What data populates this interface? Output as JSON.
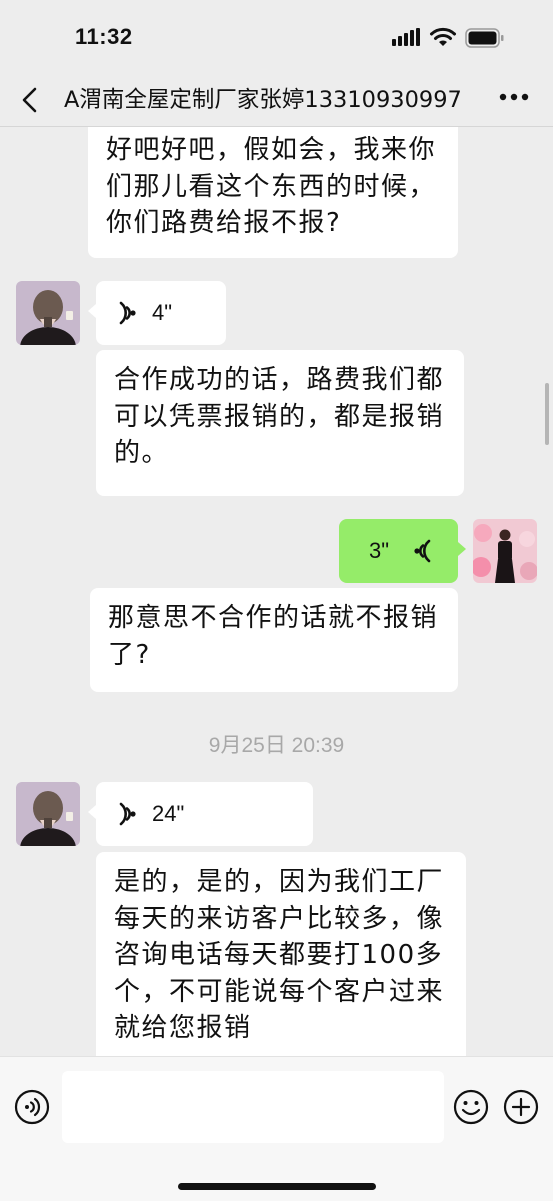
{
  "status_bar": {
    "time": "11:32"
  },
  "header": {
    "title": "A渭南全屋定制厂家张婷13310930997"
  },
  "messages": [
    {
      "from": "self",
      "type": "text",
      "text": "好吧好吧，假如会，我来你们那儿看这个东西的时候，你们路费给报不报?"
    },
    {
      "from": "other",
      "type": "voice",
      "duration": "4\""
    },
    {
      "from": "other",
      "type": "text",
      "text": "合作成功的话，路费我们都可以凭票报销的，都是报销的。"
    },
    {
      "from": "self",
      "type": "voice",
      "duration": "3\""
    },
    {
      "from": "self",
      "type": "text",
      "text": "那意思不合作的话就不报销了?"
    },
    {
      "type": "timestamp",
      "text": "9月25日 20:39"
    },
    {
      "from": "other",
      "type": "voice",
      "duration": "24\""
    },
    {
      "from": "other",
      "type": "text",
      "text": "是的，是的，因为我们工厂每天的来访客户比较多，像咨询电话每天都要打100多个，不可能说每个客户过来就给您报销"
    }
  ],
  "input": {
    "placeholder": ""
  },
  "colors": {
    "background": "#ededed",
    "self_bubble": "#95ec69",
    "other_bubble": "#ffffff",
    "timestamp": "#a8a8a8"
  }
}
